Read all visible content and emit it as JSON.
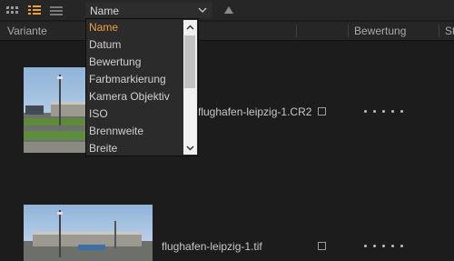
{
  "toolbar": {
    "icons": [
      "grid-view-icon",
      "list-view-icon",
      "detail-view-icon"
    ],
    "active_view": "list-view-icon",
    "sort_field": "Name",
    "accent": "#f0a040"
  },
  "columns": {
    "variant": "Variante",
    "rating": "Bewertung",
    "truncated": "St"
  },
  "rows": [
    {
      "filename": "flughafen-leipzig-1.CR2",
      "rating_dots": 5
    },
    {
      "filename": "flughafen-leipzig-1.tif",
      "rating_dots": 5
    }
  ],
  "dropdown": {
    "options": [
      "Name",
      "Datum",
      "Bewertung",
      "Farbmarkierung",
      "Kamera Objektiv",
      "ISO",
      "Brennweite",
      "Breite"
    ],
    "selected": "Name"
  }
}
